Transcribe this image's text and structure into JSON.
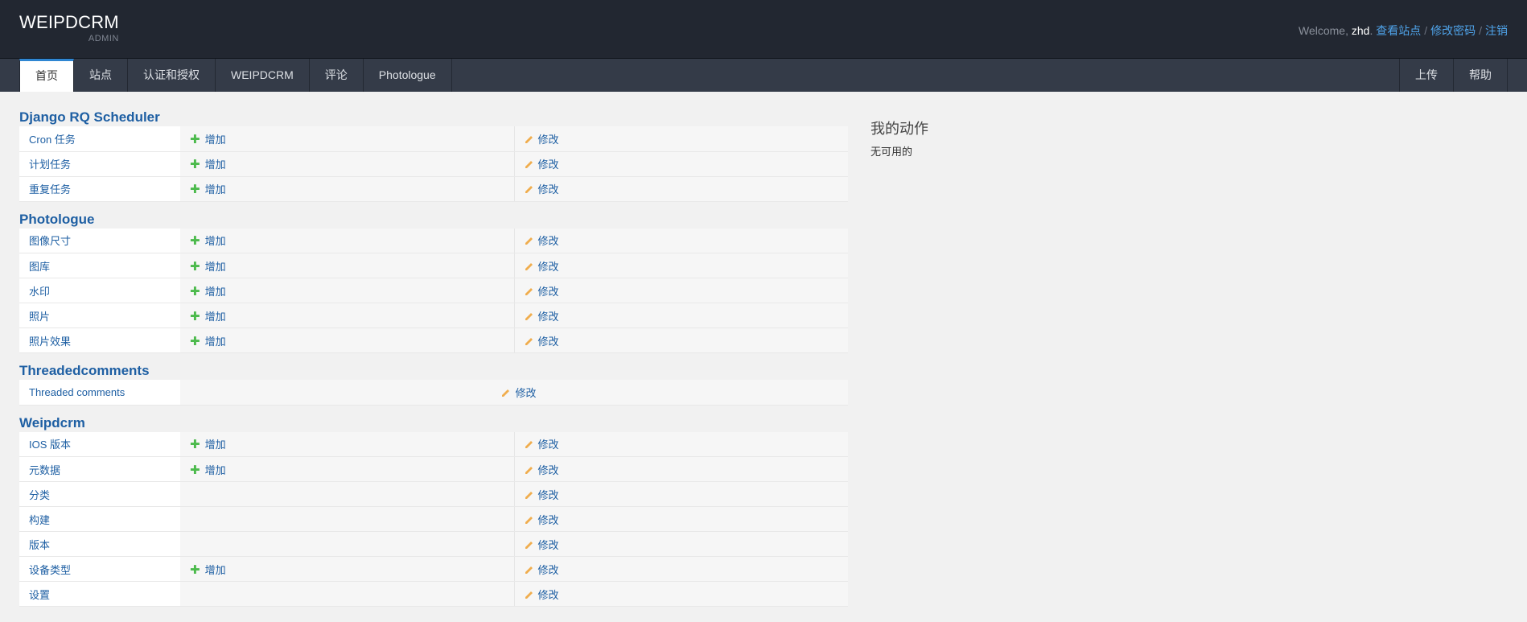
{
  "header": {
    "brand": "WEIPDCRM",
    "brand_sub": "ADMIN",
    "welcome": "Welcome, ",
    "username": "zhd",
    "punct": ".",
    "links": [
      "查看站点",
      "修改密码",
      "注销"
    ]
  },
  "nav": {
    "left": [
      "首页",
      "站点",
      "认证和授权",
      "WEIPDCRM",
      "评论",
      "Photologue"
    ],
    "right": [
      "上传",
      "帮助"
    ]
  },
  "actions": {
    "add": "增加",
    "change": "修改"
  },
  "modules": {
    "rq": {
      "title": "Django RQ Scheduler",
      "rows": [
        "Cron 任务",
        "计划任务",
        "重复任务"
      ]
    },
    "photologue": {
      "title": "Photologue",
      "rows": [
        "图像尺寸",
        "图库",
        "水印",
        "照片",
        "照片效果"
      ]
    },
    "threaded": {
      "title": "Threadedcomments",
      "rows": [
        "Threaded comments"
      ]
    },
    "weipdcrm": {
      "title": "Weipdcrm",
      "rows": [
        "IOS 版本",
        "元数据",
        "分类",
        "构建",
        "版本",
        "设备类型",
        "设置"
      ]
    }
  },
  "sidebar": {
    "title": "我的动作",
    "empty": "无可用的"
  },
  "colors": {
    "header_bg": "#222731",
    "nav_bg": "#343b48",
    "link": "#1e5fa3",
    "add_icon": "#4cba4c",
    "change_icon": "#f0ad4e"
  }
}
